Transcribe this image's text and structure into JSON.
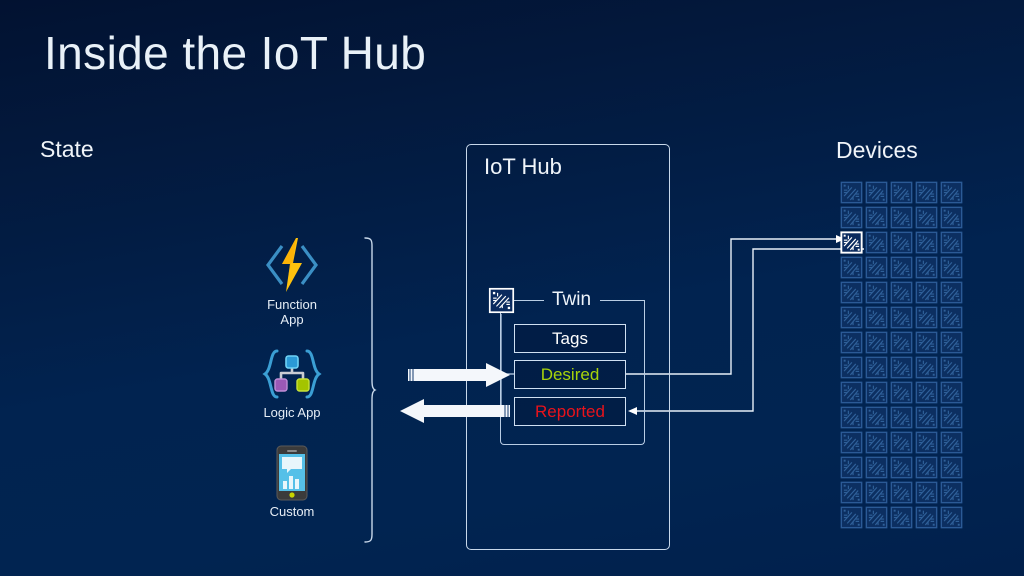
{
  "slide": {
    "title": "Inside the IoT Hub",
    "background_top": "#021231",
    "background_bottom": "#01204c"
  },
  "columns": {
    "state_label": "State",
    "devices_label": "Devices"
  },
  "hub": {
    "title": "IoT Hub",
    "twin_label": "Twin",
    "twin_icon": "chip-icon",
    "rows": [
      {
        "label": "Tags",
        "color": "#ffffff"
      },
      {
        "label": "Desired",
        "color": "#a8d30a"
      },
      {
        "label": "Reported",
        "color": "#e8131b"
      }
    ]
  },
  "state_icons": [
    {
      "name": "function-app",
      "icon": "azure-function-lightning-icon",
      "label_line1": "Function",
      "label_line2": "App"
    },
    {
      "name": "logic-app",
      "icon": "azure-logic-app-braces-icon",
      "label_line1": "Logic App",
      "label_line2": ""
    },
    {
      "name": "custom",
      "icon": "mobile-device-chart-icon",
      "label_line1": "Custom",
      "label_line2": ""
    }
  ],
  "arrows": {
    "to_hub": "write-desired-properties-arrow",
    "from_hub": "read-reported-properties-arrow"
  },
  "devices": {
    "columns": 5,
    "rows": 14,
    "total": 70,
    "highlighted_index": 10,
    "icon": "chip-icon"
  },
  "colors": {
    "outline": "#c8d8ea",
    "desired": "#a8d30a",
    "reported": "#e8131b",
    "device_dim": "#123a6e",
    "device_active": "#ffffff",
    "azure_yellow": "#ffc20e",
    "azure_blue": "#3b8fc4"
  }
}
